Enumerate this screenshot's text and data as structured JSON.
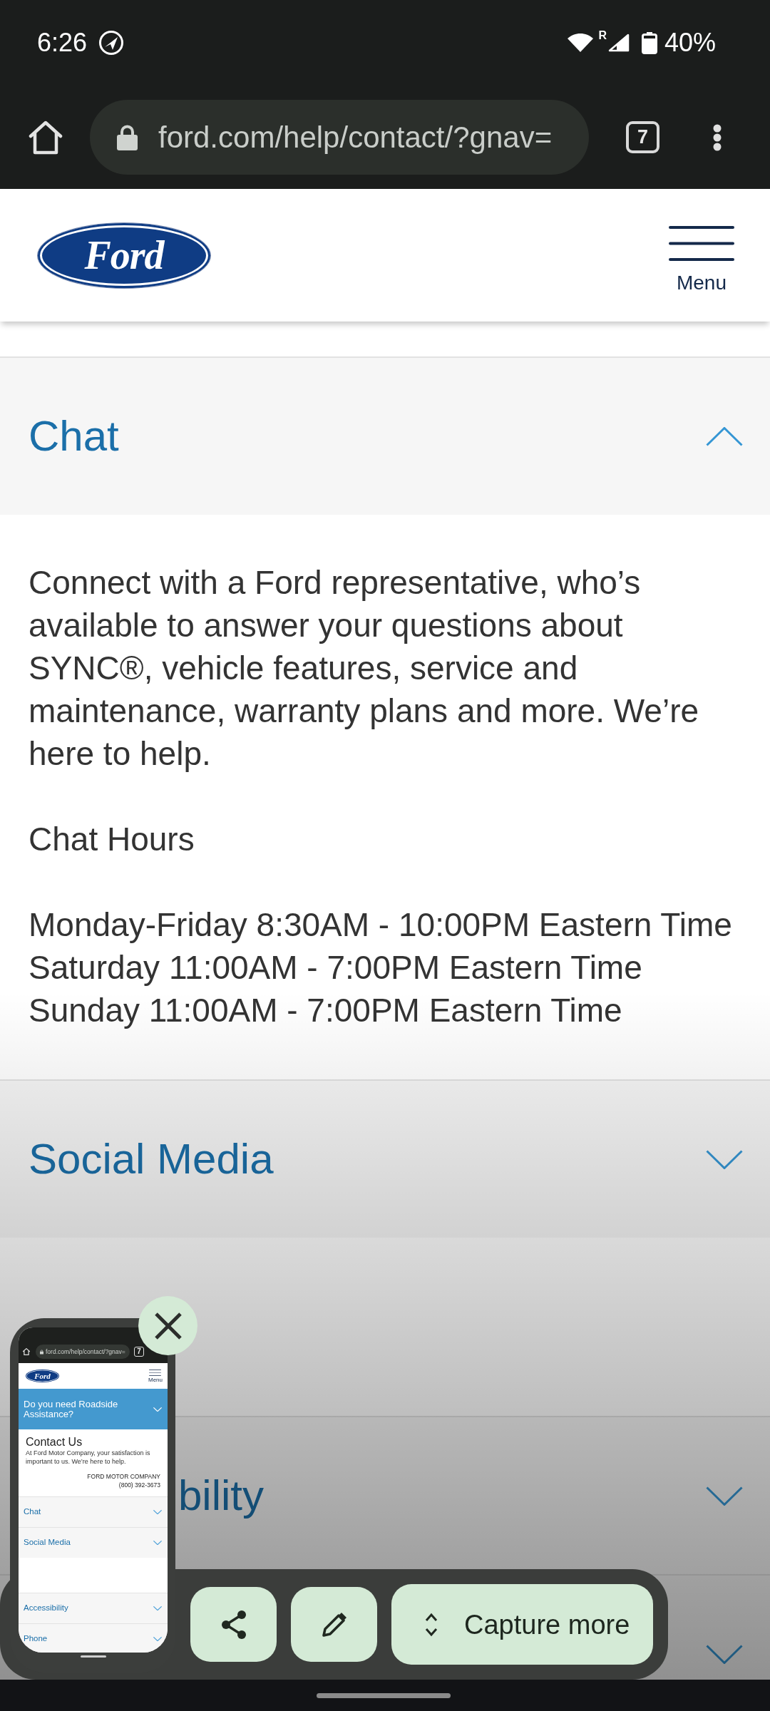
{
  "status_bar": {
    "time": "6:26",
    "roaming": "R",
    "battery": "40%"
  },
  "browser": {
    "url": "ford.com/help/contact/?gnav=",
    "tab_count": "7"
  },
  "header": {
    "logo_text": "Ford",
    "menu_label": "Menu"
  },
  "sections": [
    {
      "kind": "accordion",
      "title": "Chat",
      "expanded": true,
      "paragraph": "Connect with a Ford representative, who’s available to answer your questions about SYNC®, vehicle features, service and maintenance, warranty plans and more. We’re here to help.",
      "hours_title": "Chat Hours",
      "hours": [
        "Monday-Friday 8:30AM - 10:00PM Eastern Time",
        "Saturday 11:00AM - 7:00PM Eastern Time",
        "Sunday 11:00AM - 7:00PM Eastern Time"
      ]
    },
    {
      "kind": "accordion",
      "title": "Social Media",
      "expanded": false
    },
    {
      "kind": "blank"
    },
    {
      "kind": "accordion",
      "title": "bility",
      "expanded": false
    },
    {
      "kind": "accordion",
      "expanded": false
    }
  ],
  "screenshot_preview": {
    "url": "ford.com/help/contact/?gnav=",
    "tab_count": "7",
    "logo_text": "Ford",
    "menu_label": "Menu",
    "banner": "Do you need Roadside Assistance?",
    "heading": "Contact Us",
    "intro": "At Ford Motor Company, your satisfaction is important to us. We’re here to help.",
    "company": "FORD MOTOR COMPANY",
    "phone": "(800) 392-3673",
    "sections": [
      {
        "kind": "accordion",
        "title": "Chat",
        "expanded": false
      },
      {
        "kind": "accordion",
        "title": "Social Media",
        "expanded": false
      },
      {
        "kind": "blank"
      },
      {
        "kind": "accordion",
        "title": "Accessibility",
        "expanded": false
      },
      {
        "kind": "accordion",
        "title": "Phone",
        "expanded": false
      }
    ]
  },
  "actions": [
    {
      "kind": "share"
    },
    {
      "kind": "edit"
    },
    {
      "kind": "expand",
      "label": "Capture more"
    }
  ]
}
